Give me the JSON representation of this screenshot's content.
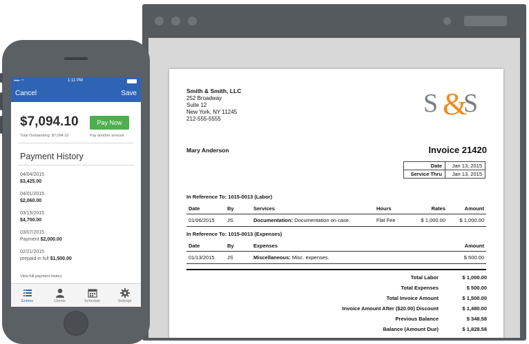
{
  "invoice": {
    "company": {
      "name": "Smith & Smith, LLC",
      "address1": "252 Broadway",
      "address2": "Suite 12",
      "city_state_zip": "New York, NY 11245",
      "phone": "212-555-5555",
      "logo_text": "S&S"
    },
    "client_name": "Mary Anderson",
    "title": "Invoice 21420",
    "meta": [
      {
        "label": "Date",
        "value": "Jan 13, 2015"
      },
      {
        "label": "Service Thru",
        "value": "Jan 13, 2015"
      }
    ],
    "sections": [
      {
        "heading": "In Reference To: 1015-0013 (Labor)",
        "columns": [
          "Date",
          "By",
          "Services",
          "Hours",
          "Rates",
          "Amount"
        ],
        "rows": [
          {
            "date": "01/06/2015",
            "by": "JS",
            "item_bold": "Documentation:",
            "item_desc": " Documentation on case.",
            "hours": "Flat Fee",
            "rate": "$ 1,000.00",
            "amount": "$ 1,000.00"
          }
        ]
      },
      {
        "heading": "In Reference To: 1015-0013 (Expenses)",
        "columns": [
          "Date",
          "By",
          "Expenses",
          "Amount"
        ],
        "rows": [
          {
            "date": "01/13/2015",
            "by": "JS",
            "item_bold": "Miscellaneous:",
            "item_desc": " Misc. expenses.",
            "amount": "$ 500.00"
          }
        ]
      }
    ],
    "totals": [
      {
        "label": "Total Labor",
        "value": "$ 1,000.00"
      },
      {
        "label": "Total Expenses",
        "value": "$ 500.00"
      },
      {
        "label": "Total Invoice Amount",
        "value": "$ 1,500.00"
      },
      {
        "label": "Invoice Amount After ($20.00) Discount",
        "value": "$ 1,480.00"
      },
      {
        "label": "Previous Balance",
        "value": "$ 348.58"
      },
      {
        "label": "Balance (Amount Due)",
        "value": "$ 1,828.58"
      }
    ]
  },
  "phone": {
    "status": {
      "carrier": "•••• ",
      "time": "1:11 PM"
    },
    "nav": {
      "cancel": "Cancel",
      "save": "Save"
    },
    "amount": "$7,094.10",
    "pay_now": "Pay Now",
    "outstanding": "Total Outstanding: $7,094.10",
    "pay_another": "Pay another amount",
    "history_title": "Payment History",
    "payments": [
      {
        "date": "04/04/2015",
        "prefix": "",
        "amount": "$3,425.00"
      },
      {
        "date": "04/01/2015",
        "prefix": "",
        "amount": "$2,060.00"
      },
      {
        "date": "03/15/2015",
        "prefix": "",
        "amount": "$4,700.00"
      },
      {
        "date": "03/07/2015",
        "prefix": "Payment ",
        "amount": "$2,000.00"
      },
      {
        "date": "02/21/2015",
        "prefix": "prepaid in full ",
        "amount": "$1,500.00"
      }
    ],
    "view_all": "View full payment history",
    "tabs": [
      {
        "label": "Entries",
        "icon": "list-icon"
      },
      {
        "label": "Clients",
        "icon": "person-icon"
      },
      {
        "label": "Schedule",
        "icon": "calendar-icon"
      },
      {
        "label": "Settings",
        "icon": "gear-icon"
      }
    ],
    "accent_color": "#2f63b3",
    "pay_button_color": "#4fae4f"
  }
}
